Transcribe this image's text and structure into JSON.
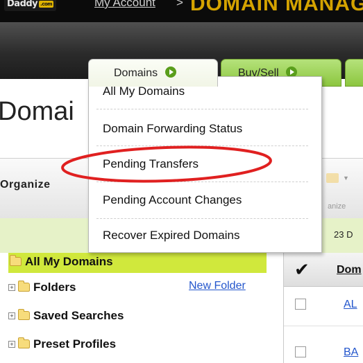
{
  "header": {
    "logo_text": "Daddy",
    "logo_badge": ".com",
    "account_link": "My Account",
    "separator": ">",
    "section_title": "DOMAIN MANAGER"
  },
  "tabs": [
    {
      "label": "Domains"
    },
    {
      "label": "Buy/Sell"
    }
  ],
  "dropdown": {
    "items": [
      {
        "label": "All My Domains"
      },
      {
        "label": "Domain Forwarding Status"
      },
      {
        "label": "Pending Transfers"
      },
      {
        "label": "Pending Account Changes"
      },
      {
        "label": "Recover Expired Domains"
      }
    ]
  },
  "page": {
    "title": "Domai"
  },
  "toolbar": {
    "organize_label": "Organize",
    "organize_caption": "anize",
    "count_label": "23 D"
  },
  "sidebar": {
    "items": [
      {
        "label": "All My Domains"
      },
      {
        "label": "Folders"
      },
      {
        "label": "Saved Searches"
      },
      {
        "label": "Preset Profiles"
      }
    ],
    "new_folder_link": "New Folder"
  },
  "grid": {
    "check_header": "✔",
    "column_header": "Dom",
    "rows": [
      {
        "link": "AL"
      },
      {
        "link": "BA"
      }
    ]
  },
  "colors": {
    "header_bg": "#0b0b0b",
    "active_tab": "#f1f5e6",
    "green_tab": "#8cc63f",
    "selected_row": "#d0e83c",
    "link": "#2255cc",
    "annotation": "#e02020"
  }
}
